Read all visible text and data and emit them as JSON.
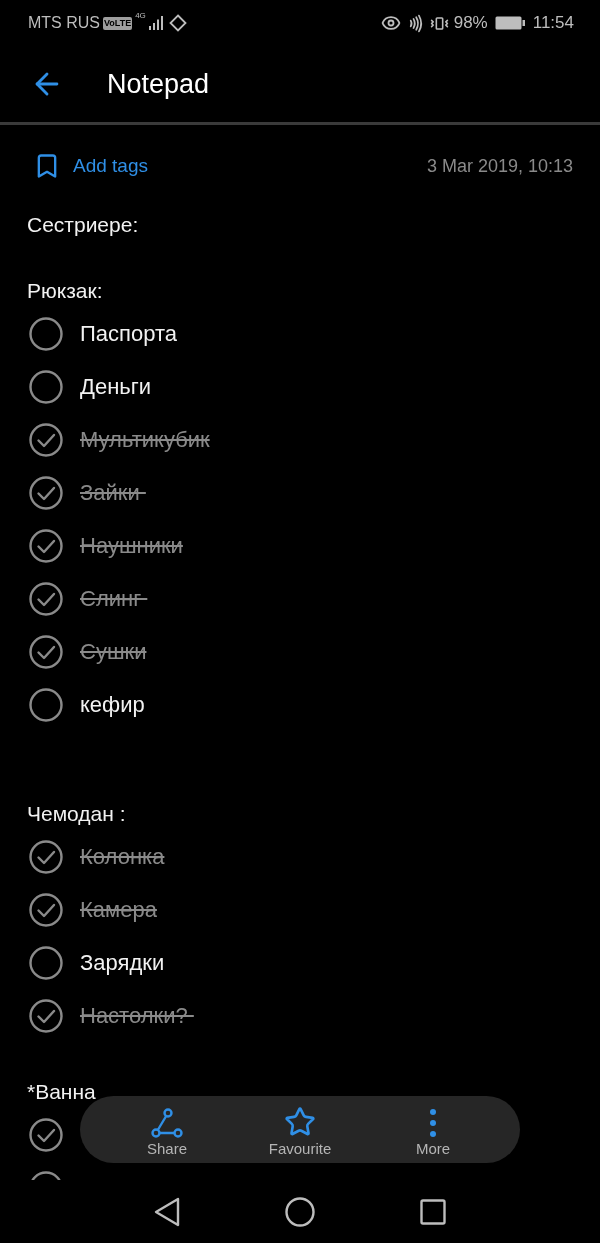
{
  "status_bar": {
    "carrier": "MTS RUS",
    "volte": "VoLTE",
    "network": "4G",
    "battery": "98%",
    "time": "11:54"
  },
  "header": {
    "title": "Notepad"
  },
  "meta": {
    "add_tags": "Add tags",
    "date": "3 Mar 2019, 10:13"
  },
  "note": {
    "lines": [
      {
        "kind": "text",
        "text": "Сестриере:"
      },
      {
        "kind": "blank"
      },
      {
        "kind": "text",
        "text": "Рюкзак:"
      },
      {
        "kind": "item",
        "text": "Паспорта",
        "checked": false
      },
      {
        "kind": "item",
        "text": "Деньги",
        "checked": false
      },
      {
        "kind": "item",
        "text": "Мультикубик",
        "checked": true
      },
      {
        "kind": "item",
        "text": "Зайки ",
        "checked": true
      },
      {
        "kind": "item",
        "text": "Наушники",
        "checked": true
      },
      {
        "kind": "item",
        "text": "Слинг ",
        "checked": true
      },
      {
        "kind": "item",
        "text": "Сушки",
        "checked": true
      },
      {
        "kind": "item",
        "text": "кефир",
        "checked": false
      },
      {
        "kind": "blank"
      },
      {
        "kind": "blank"
      },
      {
        "kind": "text",
        "text": "Чемодан :"
      },
      {
        "kind": "item",
        "text": "Колонка",
        "checked": true
      },
      {
        "kind": "item",
        "text": "Камера",
        "checked": true
      },
      {
        "kind": "item",
        "text": "Зарядки",
        "checked": false
      },
      {
        "kind": "item",
        "text": "Настолки? ",
        "checked": true
      },
      {
        "kind": "blank"
      },
      {
        "kind": "text",
        "text": "*Ванна"
      },
      {
        "kind": "item",
        "checked": true
      },
      {
        "kind": "item"
      }
    ]
  },
  "action_bar": [
    {
      "kind": "share",
      "label": "Share"
    },
    {
      "kind": "favourite",
      "label": "Favourite"
    },
    {
      "kind": "more",
      "label": "More"
    }
  ],
  "nav_bar": [
    {
      "kind": "back"
    },
    {
      "kind": "home"
    },
    {
      "kind": "recents"
    }
  ]
}
